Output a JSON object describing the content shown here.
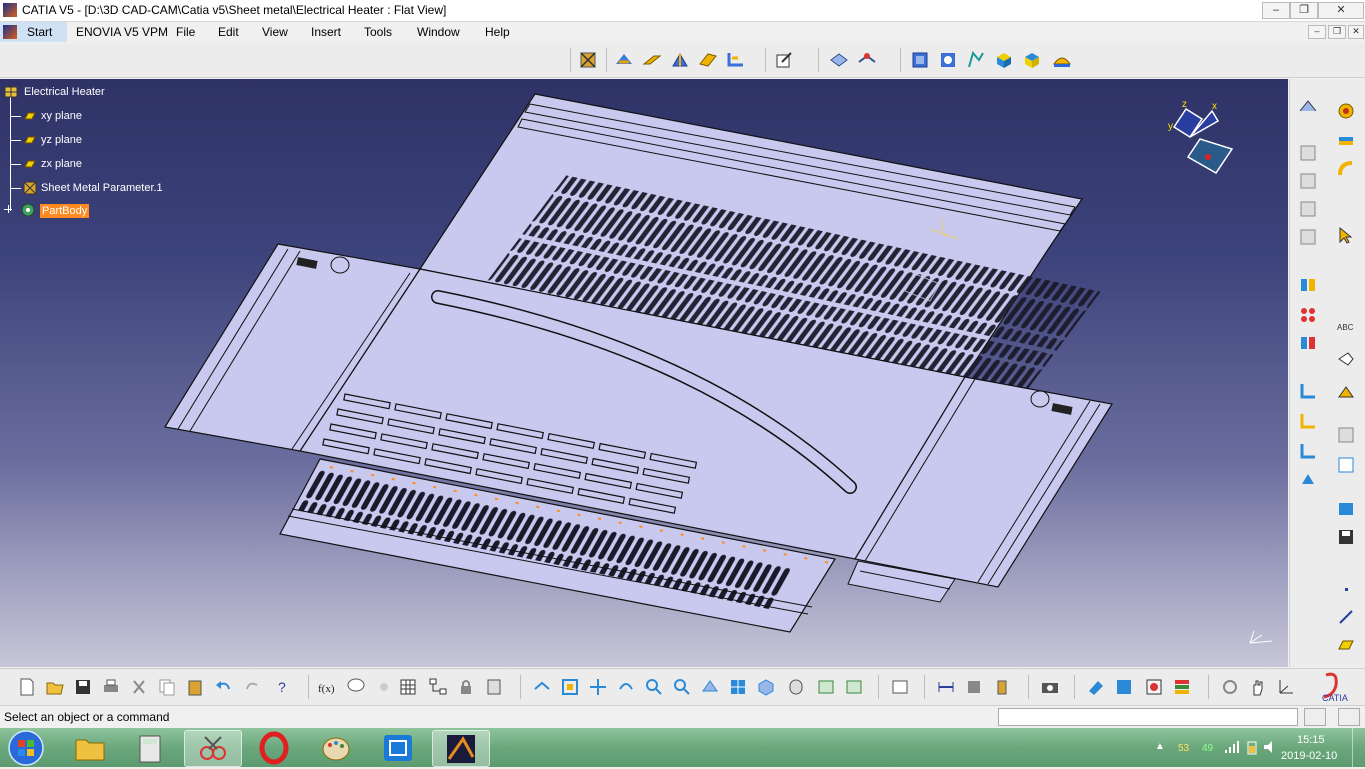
{
  "window": {
    "title": "CATIA V5 - [D:\\3D CAD-CAM\\Catia v5\\Sheet metal\\Electrical Heater : Flat View]",
    "minimize": "–",
    "maximize": "❐",
    "close": "✕"
  },
  "menu": {
    "items": [
      "Start",
      "ENOVIA V5 VPM",
      "File",
      "Edit",
      "View",
      "Insert",
      "Tools",
      "Window",
      "Help"
    ]
  },
  "tree": {
    "root": "Electrical Heater",
    "items": [
      "xy plane",
      "yz plane",
      "zx plane",
      "Sheet Metal Parameter.1",
      "PartBody"
    ],
    "selected": "PartBody"
  },
  "compass": {
    "x": "x",
    "y": "y",
    "z": "z"
  },
  "status": {
    "message": "Select an object or a command",
    "command_value": ""
  },
  "taskbar": {
    "time": "15:15",
    "date": "2019-02-10",
    "tray_a": "53",
    "tray_b": "49"
  },
  "colors": {
    "accent": "#ff8a1f",
    "part_fill": "#c9c9f0",
    "viewport_top": "#2e3266",
    "viewport_bottom": "#c8c7d8"
  }
}
